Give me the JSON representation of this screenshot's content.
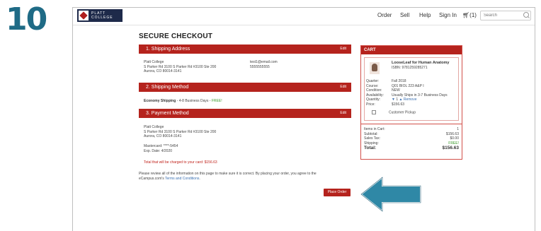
{
  "step_number": "10",
  "header": {
    "logo_line1": "PLATT",
    "logo_line2": "COLLEGE",
    "nav": [
      "Order",
      "Sell",
      "Help",
      "Sign In"
    ],
    "cart_count": "(1)",
    "search_placeholder": "Search"
  },
  "page_title": "SECURE CHECKOUT",
  "shipping_address": {
    "title": "1. Shipping Address",
    "edit": "Edit",
    "name": "Platt College",
    "line1": "S Parker Rd 3100 S Parker Rd #3100 Ste 200",
    "line2": "Aurora, CO 80014-3141",
    "email": "test1@email.com",
    "phone": "5555555555"
  },
  "shipping_method": {
    "title": "2. Shipping Method",
    "edit": "Edit",
    "method": "Economy Shipping",
    "detail": "- 4-8 Business Days -",
    "free": "FREE!"
  },
  "payment_method": {
    "title": "3. Payment Method",
    "edit": "Edit",
    "name": "Platt College",
    "line1": "S Parker Rd 3100 S Parker Rd #3100 Ste 200",
    "line2": "Aurora, CO 80014-3141",
    "card": "Mastercard: ****-5454",
    "exp": "Exp. Date: 4/2020",
    "total_note": "Total that will be charged to your card: $156.63"
  },
  "review": {
    "line1": "Please review all of the information on this page to make sure it is correct. By placing your order, you agree to the",
    "line2_prefix": "eCampus.com's",
    "terms_link": "Terms and Conditions",
    "line2_suffix": "."
  },
  "place_order": "Place Order",
  "cart": {
    "title": "CART",
    "item": {
      "name": "LooseLeaf for Human Anatomy",
      "isbn": "ISBN: 9781259285271",
      "labels": [
        "Quarter:",
        "Course:",
        "Condition:",
        "Availability:",
        "Quantity:",
        "Price:"
      ],
      "quarter": "Fall 2018",
      "course": "Q01 BIOL 223 A&P I",
      "condition": "NEW",
      "availability": "Usually Ships in 3-7 Business Days",
      "quantity": "1",
      "remove": "Remove",
      "price": "$156.63",
      "pickup": "Customer Pickup"
    },
    "summary": {
      "items_label": "Items in Cart:",
      "items_value": "1",
      "subtotal_label": "Subtotal:",
      "subtotal_value": "$156.63",
      "tax_label": "Sales Tax:",
      "tax_value": "$0.00",
      "shipping_label": "Shipping:",
      "shipping_value": "FREE!",
      "total_label": "Total:",
      "total_value": "$156.63"
    }
  },
  "colors": {
    "brand_red": "#b5231d",
    "step_blue": "#1f6b86",
    "free_green": "#3a9a2a",
    "link_blue": "#3a6fb0"
  }
}
